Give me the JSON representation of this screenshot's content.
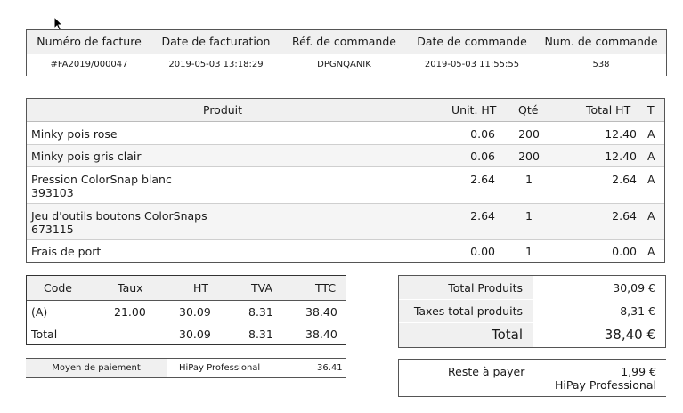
{
  "invoice_header": {
    "columns": [
      "Numéro de facture",
      "Date de facturation",
      "Réf. de commande",
      "Date de commande",
      "Num. de commande"
    ],
    "values": [
      "#FA2019/000047",
      "2019-05-03 13:18:29",
      "DPGNQANIK",
      "2019-05-03 11:55:55",
      "538"
    ]
  },
  "products": {
    "headers": {
      "product": "Produit",
      "unit": "Unit. HT",
      "qty": "Qté",
      "total": "Total HT",
      "tax": "T"
    },
    "rows": [
      {
        "name": "Minky pois rose",
        "ref": "",
        "unit": "0.06",
        "qty": "200",
        "total": "12.40",
        "tax": "A"
      },
      {
        "name": "Minky pois gris clair",
        "ref": "",
        "unit": "0.06",
        "qty": "200",
        "total": "12.40",
        "tax": "A"
      },
      {
        "name": "Pression ColorSnap blanc",
        "ref": "393103",
        "unit": "2.64",
        "qty": "1",
        "total": "2.64",
        "tax": "A"
      },
      {
        "name": "Jeu d'outils boutons ColorSnaps",
        "ref": "673115",
        "unit": "2.64",
        "qty": "1",
        "total": "2.64",
        "tax": "A"
      },
      {
        "name": "Frais de port",
        "ref": "",
        "unit": "0.00",
        "qty": "1",
        "total": "0.00",
        "tax": "A"
      }
    ]
  },
  "tax_table": {
    "headers": [
      "Code",
      "Taux",
      "HT",
      "TVA",
      "TTC"
    ],
    "rows": [
      [
        "(A)",
        "21.00",
        "30.09",
        "8.31",
        "38.40"
      ],
      [
        "Total",
        "",
        "30.09",
        "8.31",
        "38.40"
      ]
    ]
  },
  "payment": {
    "label": "Moyen de paiement",
    "method": "HiPay Professional",
    "amount": "36.41"
  },
  "totals": {
    "products_label": "Total Produits",
    "products_value": "30,09 €",
    "taxes_label": "Taxes total produits",
    "taxes_value": "8,31 €",
    "total_label": "Total",
    "total_value": "38,40 €"
  },
  "remaining": {
    "label": "Reste à payer",
    "amount": "1,99 €",
    "method": "HiPay Professional"
  }
}
